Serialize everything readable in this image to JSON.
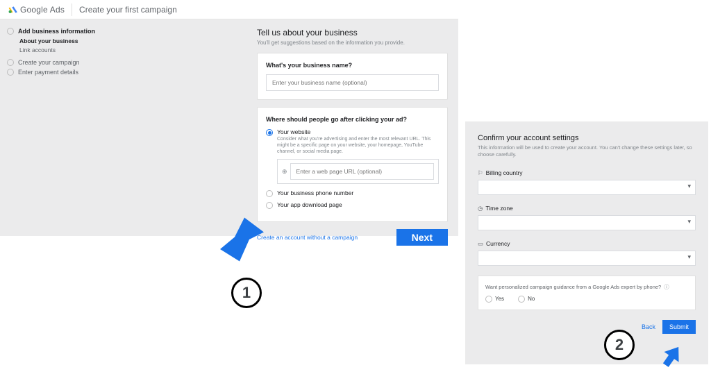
{
  "header": {
    "product": "Google Ads",
    "page_title": "Create your first campaign"
  },
  "sidebar": {
    "steps": [
      {
        "label": "Add business information",
        "active": true,
        "substeps": [
          {
            "label": "About your business",
            "active": true
          },
          {
            "label": "Link accounts",
            "active": false
          }
        ]
      },
      {
        "label": "Create your campaign",
        "active": false
      },
      {
        "label": "Enter payment details",
        "active": false
      }
    ]
  },
  "form1": {
    "heading": "Tell us about your business",
    "lead": "You'll get suggestions based on the information you provide.",
    "card_name": {
      "question": "What's your business name?",
      "placeholder": "Enter your business name (optional)"
    },
    "card_dest": {
      "question": "Where should people go after clicking your ad?",
      "opt_website_title": "Your website",
      "opt_website_desc": "Consider what you're advertising and enter the most relevant URL. This might be a specific page on your website, your homepage, YouTube channel, or social media page.",
      "url_placeholder": "Enter a web page URL (optional)",
      "opt_phone": "Your business phone number",
      "opt_app": "Your app download page"
    },
    "footer": {
      "skip_link": "Create an account without a campaign",
      "next": "Next"
    }
  },
  "form2": {
    "heading": "Confirm your account settings",
    "lead": "This information will be used to create your account. You can't change these settings later, so choose carefully.",
    "field_country": "Billing country",
    "field_tz": "Time zone",
    "field_currency": "Currency",
    "survey_q": "Want personalized campaign guidance from a Google Ads expert by phone?",
    "survey_yes": "Yes",
    "survey_no": "No",
    "back": "Back",
    "submit": "Submit"
  },
  "annot": {
    "one": "1",
    "two": "2"
  }
}
